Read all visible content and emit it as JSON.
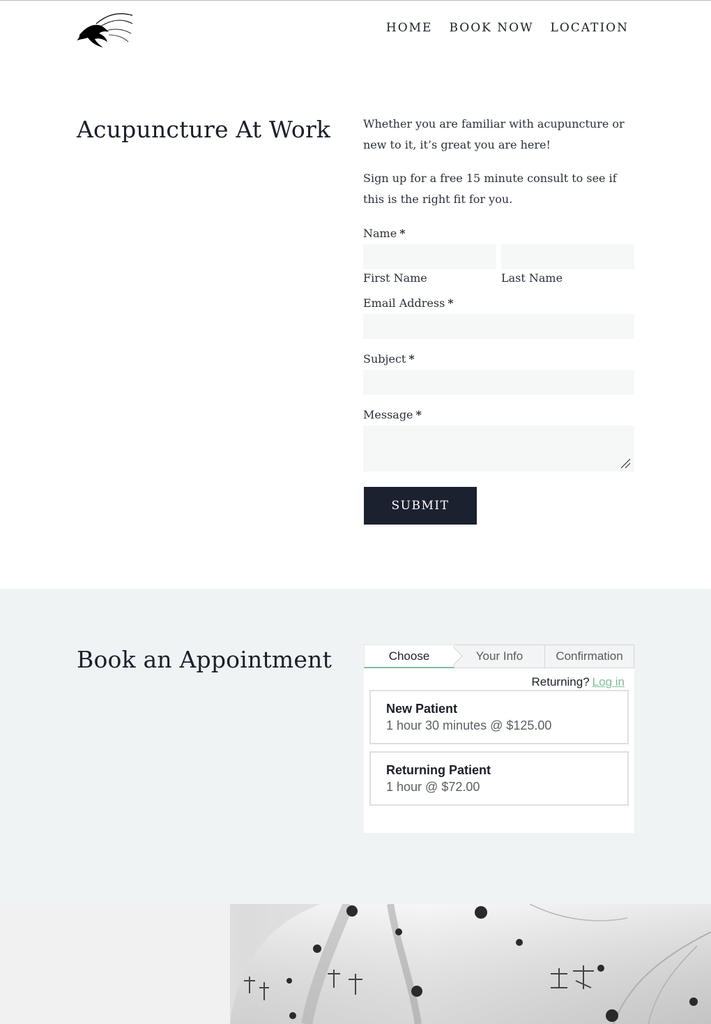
{
  "nav": {
    "home": "HOME",
    "book_now": "BOOK NOW",
    "location": "LOCATION"
  },
  "contact": {
    "title": "Acupuncture At Work",
    "intro_1": "Whether you are familiar with acupuncture or new to it, it’s great you are here!",
    "intro_2": "Sign up for a free 15 minute consult to see if this is the right fit for you.",
    "required_mark": "*",
    "name_label": "Name",
    "first_name_label": "First Name",
    "last_name_label": "Last Name",
    "email_label": "Email Address",
    "subject_label": "Subject",
    "message_label": "Message",
    "submit_label": "SUBMIT"
  },
  "booking": {
    "title": "Book an Appointment",
    "tabs": [
      "Choose",
      "Your Info",
      "Confirmation"
    ],
    "active_tab": "Choose",
    "returning_text": "Returning?",
    "login_link": "Log in",
    "services": [
      {
        "name": "New Patient",
        "meta": "1 hour 30 minutes @ $125.00"
      },
      {
        "name": "Returning Patient",
        "meta": "1 hour @ $72.00"
      }
    ]
  },
  "colors": {
    "dark": "#1c2130",
    "band": "#f0f3f4",
    "accent_green": "#7fbf9a",
    "field_bg": "#f6f7f7"
  },
  "icons": {
    "logo": "hare-brush-logo-icon",
    "resize": "resize-grip-icon"
  }
}
